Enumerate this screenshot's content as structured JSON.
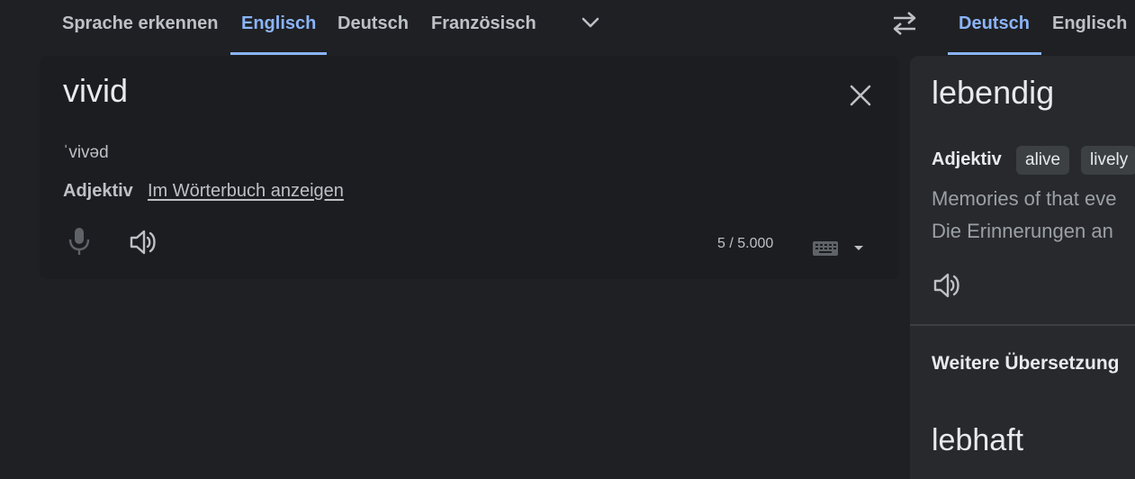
{
  "source_languages": {
    "tabs": [
      "Sprache erkennen",
      "Englisch",
      "Deutsch",
      "Französisch"
    ],
    "active_index": 1,
    "more_icon": "chevron-down-icon"
  },
  "swap_icon": "swap-languages-icon",
  "target_languages": {
    "tabs": [
      "Deutsch",
      "Englisch"
    ],
    "active_index": 0
  },
  "source": {
    "text": "vivid",
    "phonetic": "ˈvivəd",
    "part_of_speech": "Adjektiv",
    "dictionary_link": "Im Wörterbuch anzeigen",
    "char_count": "5 / 5.000",
    "clear_icon": "close-icon",
    "mic_icon": "microphone-icon",
    "speak_icon": "speaker-icon",
    "keyboard_icon": "keyboard-icon"
  },
  "target": {
    "text": "lebendig",
    "part_of_speech": "Adjektiv",
    "synonyms": [
      "alive",
      "lively"
    ],
    "example_source": "Memories of that eve",
    "example_target": "Die Erinnerungen an",
    "speak_icon": "speaker-icon",
    "more_heading": "Weitere Übersetzung",
    "alt_translation": "lebhaft"
  },
  "colors": {
    "background": "#1f2023",
    "accent": "#8ab4f8",
    "panel": "#28292c",
    "text": "#e8eaed",
    "muted_text": "#bdc1c6"
  }
}
